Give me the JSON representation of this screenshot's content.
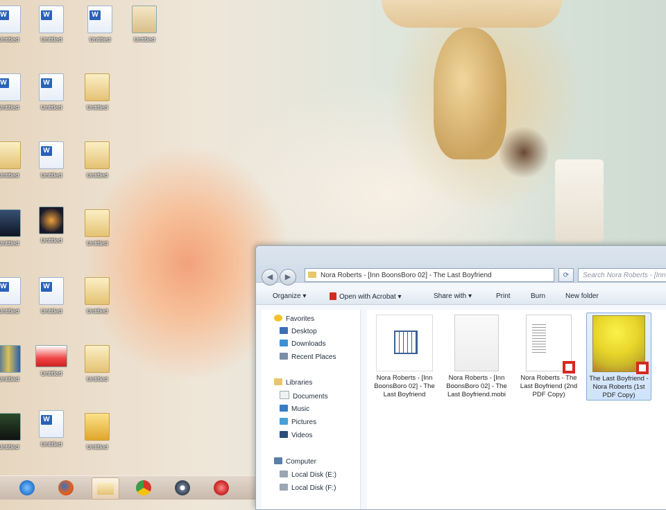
{
  "desktop": {
    "icons": [
      {
        "label": "Untitled",
        "kind": "doc"
      },
      {
        "label": "Untitled",
        "kind": "doc"
      },
      {
        "label": "Untitled",
        "kind": "doc"
      },
      {
        "label": "Untitled",
        "kind": "img"
      },
      {
        "label": "Untitled",
        "kind": "doc"
      },
      {
        "label": "Untitled",
        "kind": "doc"
      },
      {
        "label": "Untitled",
        "kind": "folder"
      },
      {
        "label": "Untitled",
        "kind": "folder"
      },
      {
        "label": "Untitled",
        "kind": "doc"
      },
      {
        "label": "Untitled",
        "kind": "folder"
      },
      {
        "label": "Untitled",
        "kind": "img"
      },
      {
        "label": "Untitled",
        "kind": "img"
      },
      {
        "label": "Untitled",
        "kind": "folder"
      },
      {
        "label": "Untitled",
        "kind": "doc"
      },
      {
        "label": "Untitled",
        "kind": "doc"
      },
      {
        "label": "Untitled",
        "kind": "folder"
      },
      {
        "label": "Untitled",
        "kind": "img"
      },
      {
        "label": "Untitled",
        "kind": "img"
      },
      {
        "label": "Untitled",
        "kind": "folder"
      },
      {
        "label": "Untitled",
        "kind": "img"
      },
      {
        "label": "Untitled",
        "kind": "doc"
      },
      {
        "label": "Untitled",
        "kind": "folder"
      }
    ]
  },
  "taskbar": {
    "items": [
      {
        "icon": "internet-explorer-icon",
        "color": "#2f7fd4"
      },
      {
        "icon": "firefox-icon",
        "color": "#e0621f"
      },
      {
        "icon": "file-explorer-icon",
        "color": "#e7c66b"
      },
      {
        "icon": "chrome-icon",
        "color": "#d8362a"
      },
      {
        "icon": "app-icon",
        "color": "#6b7a8c"
      },
      {
        "icon": "red-app-icon",
        "color": "#cc2a2a"
      }
    ]
  },
  "explorer": {
    "address": "Nora Roberts - [Inn BoonsBoro 02] - The Last Boyfriend",
    "search_placeholder": "Search Nora Roberts - [Inn",
    "toolbar": {
      "organize": "Organize ▾",
      "open_with": "Open with Acrobat ▾",
      "share_with": "Share with ▾",
      "print": "Print",
      "burn": "Burn",
      "new_folder": "New folder"
    },
    "nav": {
      "favorites": "Favorites",
      "desktop": "Desktop",
      "downloads": "Downloads",
      "recent_places": "Recent Places",
      "libraries": "Libraries",
      "documents": "Documents",
      "music": "Music",
      "pictures": "Pictures",
      "videos": "Videos",
      "computer": "Computer",
      "local_disk_e": "Local Disk (E:)",
      "local_disk_f": "Local Disk (F:)"
    },
    "files": [
      {
        "name": "Nora Roberts - [Inn BoonsBoro 02] - The Last Boyfriend",
        "kind": "calendar"
      },
      {
        "name": "Nora Roberts - [Inn BoonsBoro 02] - The Last Boyfriend.mobi",
        "kind": "blank"
      },
      {
        "name": "Nora Roberts - The Last Boyfriend (2nd PDF Copy)",
        "kind": "pdf"
      },
      {
        "name": "The Last Boyfriend - Nora Roberts (1st PDF Copy)",
        "kind": "cover"
      }
    ]
  },
  "colors": {
    "window_border": "#97a7bb",
    "selection": "#cfe3f9",
    "pdf_red": "#d42a1e"
  }
}
